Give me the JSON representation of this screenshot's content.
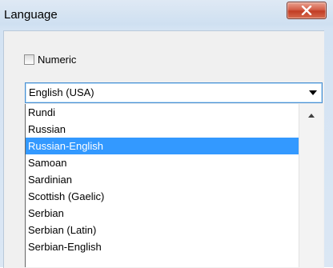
{
  "window": {
    "title": "Language"
  },
  "numeric_checkbox": {
    "label": "Numeric",
    "checked": false
  },
  "combo": {
    "selected_value": "English (USA)"
  },
  "dropdown": {
    "options": [
      "Rundi",
      "Russian",
      "Russian-English",
      "Samoan",
      "Sardinian",
      "Scottish (Gaelic)",
      "Serbian",
      "Serbian (Latin)",
      "Serbian-English"
    ],
    "highlighted_option": "Russian-English"
  },
  "icons": {
    "close": "close-icon",
    "combo_arrow": "chevron-down-icon",
    "scroll_up": "scroll-up-icon"
  },
  "colors": {
    "highlight": "#3399ff",
    "close_button": "#c23d25",
    "combo_border": "#4a8fd1"
  }
}
